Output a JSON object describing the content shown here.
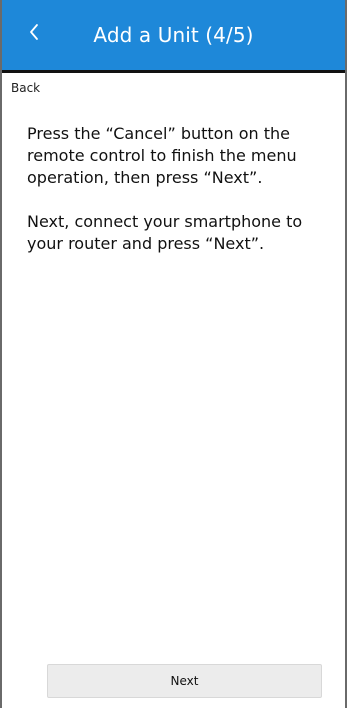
{
  "header": {
    "title": "Add a Unit (4/5)",
    "back_icon": "chevron-left-icon",
    "color": "#1e88d9"
  },
  "back_link": {
    "label": "Back"
  },
  "content": {
    "paragraph_1": "Press the “Cancel” button on the remote control to finish the menu operation, then press “Next”.",
    "paragraph_2": "Next, connect your smartphone to your router and press “Next”."
  },
  "footer": {
    "next_label": "Next"
  }
}
